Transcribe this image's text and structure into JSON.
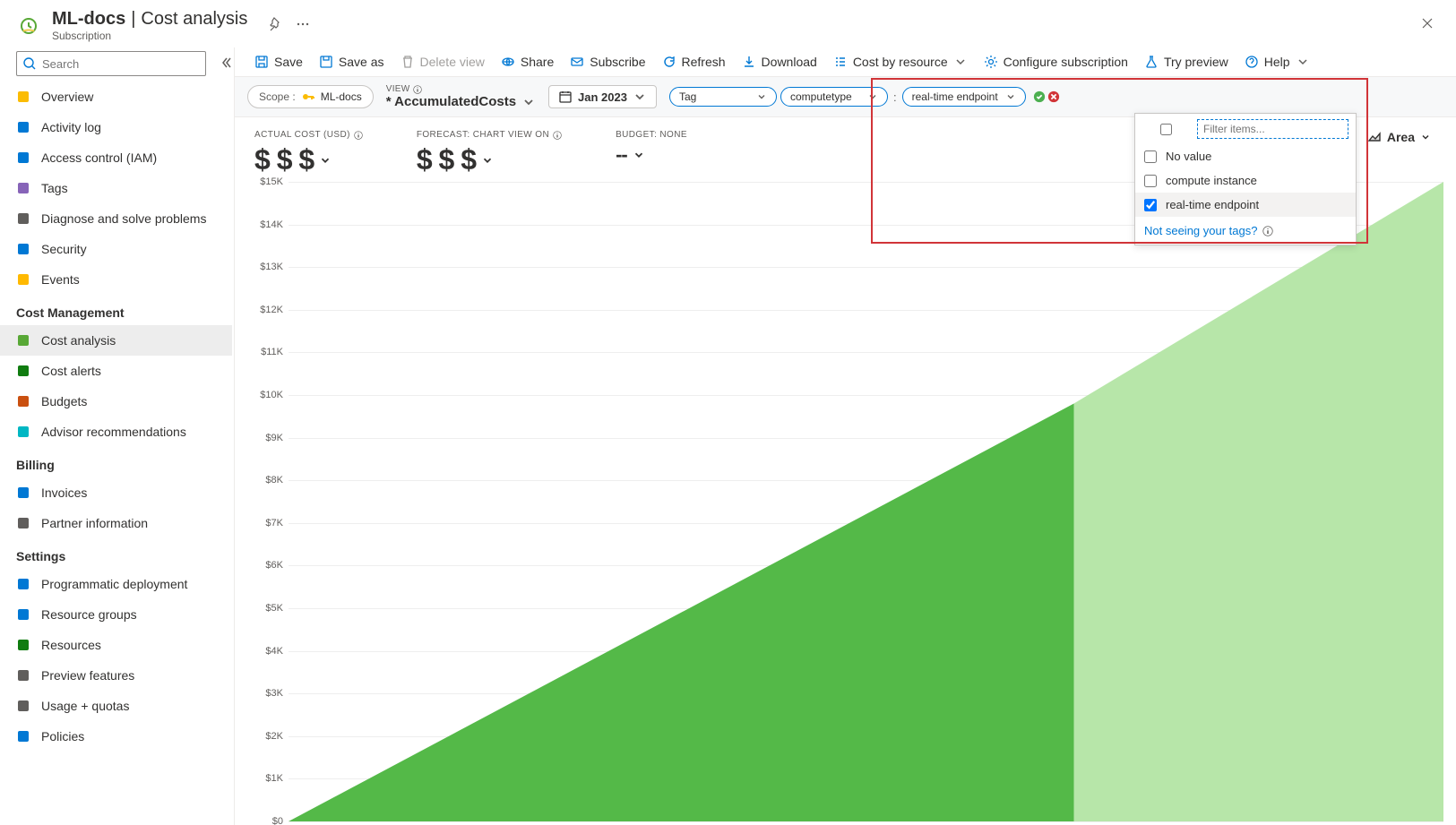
{
  "header": {
    "title_main": "ML-docs",
    "title_sep": "|",
    "title_sub": "Cost analysis",
    "subtitle": "Subscription"
  },
  "search": {
    "placeholder": "Search"
  },
  "sidebar": {
    "items_top": [
      {
        "label": "Overview",
        "icon": "#fbbc04"
      },
      {
        "label": "Activity log",
        "icon": "#0078d4"
      },
      {
        "label": "Access control (IAM)",
        "icon": "#0078d4"
      },
      {
        "label": "Tags",
        "icon": "#8764b8"
      },
      {
        "label": "Diagnose and solve problems",
        "icon": "#605e5c"
      },
      {
        "label": "Security",
        "icon": "#0078d4"
      },
      {
        "label": "Events",
        "icon": "#ffb900"
      }
    ],
    "section_cm": "Cost Management",
    "items_cm": [
      {
        "label": "Cost analysis",
        "icon": "#58a836",
        "active": true
      },
      {
        "label": "Cost alerts",
        "icon": "#107c10"
      },
      {
        "label": "Budgets",
        "icon": "#ca5010"
      },
      {
        "label": "Advisor recommendations",
        "icon": "#00b7c3"
      }
    ],
    "section_billing": "Billing",
    "items_billing": [
      {
        "label": "Invoices",
        "icon": "#0078d4"
      },
      {
        "label": "Partner information",
        "icon": "#605e5c"
      }
    ],
    "section_settings": "Settings",
    "items_settings": [
      {
        "label": "Programmatic deployment",
        "icon": "#0078d4"
      },
      {
        "label": "Resource groups",
        "icon": "#0078d4"
      },
      {
        "label": "Resources",
        "icon": "#107c10"
      },
      {
        "label": "Preview features",
        "icon": "#605e5c"
      },
      {
        "label": "Usage + quotas",
        "icon": "#605e5c"
      },
      {
        "label": "Policies",
        "icon": "#0078d4"
      }
    ]
  },
  "toolbar": {
    "save": "Save",
    "save_as": "Save as",
    "delete_view": "Delete view",
    "share": "Share",
    "subscribe": "Subscribe",
    "refresh": "Refresh",
    "download": "Download",
    "cost_by_resource": "Cost by resource",
    "configure_sub": "Configure subscription",
    "try_preview": "Try preview",
    "help": "Help"
  },
  "controls": {
    "scope_label": "Scope :",
    "scope_value": "ML-docs",
    "view_label": "VIEW",
    "view_name": "* AccumulatedCosts",
    "date": "Jan 2023",
    "filter_dim": "Tag",
    "filter_key": "computetype",
    "filter_val": "real-time endpoint"
  },
  "popup": {
    "filter_placeholder": "Filter items...",
    "rows": [
      {
        "label": "No value",
        "checked": false
      },
      {
        "label": "compute instance",
        "checked": false
      },
      {
        "label": "real-time endpoint",
        "checked": true
      }
    ],
    "link": "Not seeing your tags?"
  },
  "metrics": {
    "actual_label": "ACTUAL COST (USD)",
    "actual_value": "$ $ $",
    "forecast_label": "FORECAST: CHART VIEW ON",
    "forecast_value": "$ $ $",
    "budget_label": "BUDGET: NONE",
    "budget_value": "--",
    "area": "Area"
  },
  "chart_data": {
    "type": "area",
    "title": "",
    "xlabel": "",
    "ylabel": "",
    "ylim": [
      0,
      15000
    ],
    "y_ticks": [
      "$15K",
      "$14K",
      "$13K",
      "$12K",
      "$11K",
      "$10K",
      "$9K",
      "$8K",
      "$7K",
      "$6K",
      "$5K",
      "$4K",
      "$3K",
      "$2K",
      "$1K",
      "$0"
    ],
    "series": [
      {
        "name": "actual",
        "color": "#54b948",
        "values": [
          0,
          9800
        ],
        "x_fraction": [
          0.0,
          0.68
        ]
      },
      {
        "name": "forecast",
        "color": "#b7e6a9",
        "values": [
          9800,
          15000
        ],
        "x_fraction": [
          0.68,
          1.0
        ]
      }
    ]
  }
}
